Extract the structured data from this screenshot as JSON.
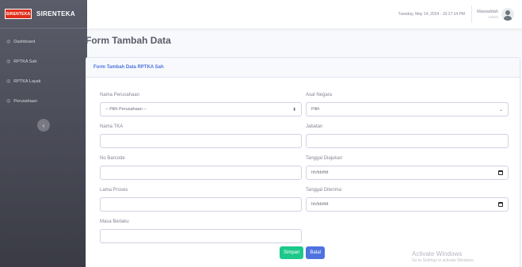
{
  "brand": {
    "logo_text": "SIRENTEKA",
    "name": "SIRENTEKA"
  },
  "sidebar": {
    "items": [
      {
        "label": "Dashboard",
        "icon": "dashboard-icon"
      },
      {
        "label": "RPTKA Sah",
        "icon": "document-icon"
      },
      {
        "label": "RPTKA Layak",
        "icon": "document-icon"
      },
      {
        "label": "Perusahaan",
        "icon": "building-icon"
      }
    ],
    "toggle_label": "‹"
  },
  "topbar": {
    "datetime": "Tuesday, May 14, 2024 - 10:17:14 PM",
    "user_name": "Mawaddah",
    "user_role": "Admin"
  },
  "page": {
    "title": "Form Tambah Data",
    "card_header": "Form Tambah Data RPTKA Sah"
  },
  "form": {
    "nama_perusahaan": {
      "label": "Nama Perusahaan",
      "value": "-- Pilih Perusahaan --"
    },
    "asal_negara": {
      "label": "Asal Negara",
      "value": "Pilih"
    },
    "nama_tka": {
      "label": "Nama TKA",
      "value": ""
    },
    "jabatan": {
      "label": "Jabatan",
      "value": ""
    },
    "no_barcode": {
      "label": "No Barcode",
      "value": ""
    },
    "tanggal_diajukan": {
      "label": "Tanggal Diajukan",
      "placeholder": "hh/bb/tttt"
    },
    "lama_proses": {
      "label": "Lama Proses",
      "value": ""
    },
    "tanggal_diterima": {
      "label": "Tanggal Diterima",
      "placeholder": "hh/bb/tttt"
    },
    "masa_berlaku": {
      "label": "Masa Berlaku",
      "value": ""
    },
    "save_label": "Simpan",
    "cancel_label": "Batal"
  },
  "watermark": {
    "title": "Activate Windows",
    "subtitle": "Go to Settings to activate Windows."
  },
  "colors": {
    "primary": "#4e73df",
    "success": "#1cc88a",
    "sidebar": "#4e4f5a",
    "logo": "#e02d1b"
  }
}
